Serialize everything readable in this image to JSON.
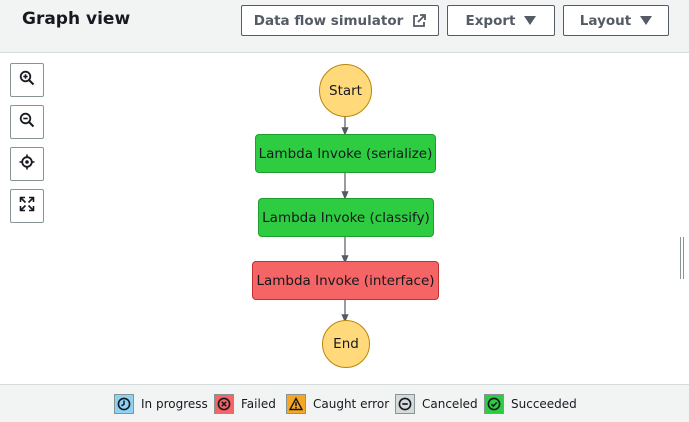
{
  "header": {
    "title": "Graph view",
    "data_flow_simulator_label": "Data flow simulator",
    "export_label": "Export",
    "layout_label": "Layout"
  },
  "zoom_controls": [
    "zoom-in-icon",
    "zoom-out-icon",
    "center-icon",
    "fit-to-screen-icon"
  ],
  "graph": {
    "start_label": "Start",
    "end_label": "End",
    "states": [
      {
        "label": "Lambda Invoke (serialize)",
        "status": "Succeeded"
      },
      {
        "label": "Lambda Invoke (classify)",
        "status": "Succeeded"
      },
      {
        "label": "Lambda Invoke (interface)",
        "status": "Failed"
      }
    ]
  },
  "legend": [
    {
      "label": "In progress",
      "color": "#8ed1f2",
      "icon": "clock-icon"
    },
    {
      "label": "Failed",
      "color": "#f56565",
      "icon": "x-circle-icon"
    },
    {
      "label": "Caught error",
      "color": "#f5a623",
      "icon": "warning-icon"
    },
    {
      "label": "Canceled",
      "color": "#d5dbdb",
      "icon": "minus-circle-icon"
    },
    {
      "label": "Succeeded",
      "color": "#2ecc40",
      "icon": "check-circle-icon"
    }
  ],
  "colors": {
    "start_end": "#ffd97a",
    "succeeded": "#2ecc40",
    "failed": "#f56565",
    "edge": "#545b64"
  }
}
